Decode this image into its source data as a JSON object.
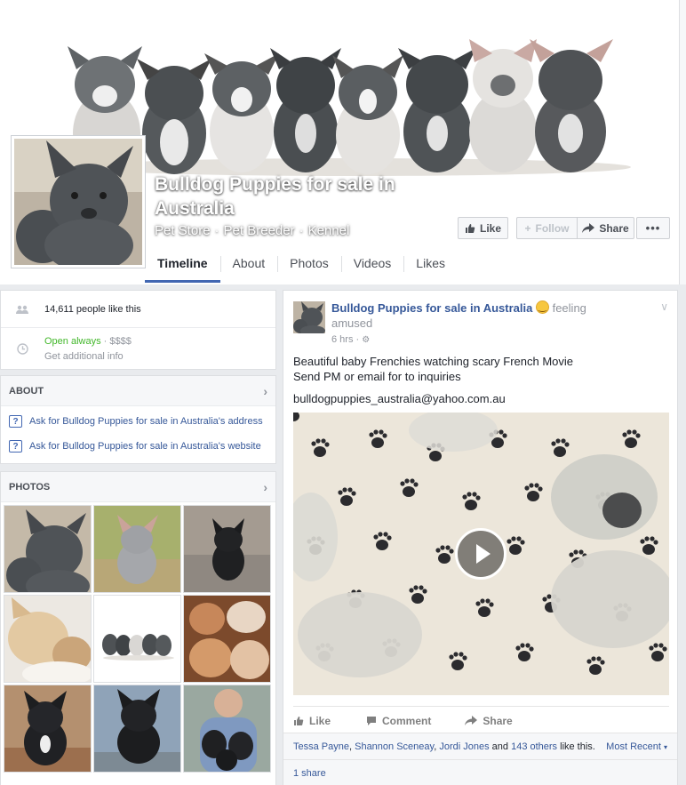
{
  "page": {
    "name": "Bulldog Puppies for sale in Australia",
    "categories": [
      "Pet Store",
      "Pet Breeder",
      "Kennel"
    ]
  },
  "header_buttons": {
    "like": "Like",
    "follow": "Follow",
    "share": "Share",
    "more": "•••"
  },
  "tabs": [
    "Timeline",
    "About",
    "Photos",
    "Videos",
    "Likes"
  ],
  "sidebar": {
    "likes_text": "14,611 people like this",
    "open_text": "Open always",
    "price_sep": " · ",
    "price": "$$$$",
    "additional_info": "Get additional info"
  },
  "about": {
    "heading": "ABOUT",
    "links": [
      "Ask for Bulldog Puppies for sale in Australia's address",
      "Ask for Bulldog Puppies for sale in Australia's website"
    ]
  },
  "photos": {
    "heading": "PHOTOS",
    "count": 9
  },
  "post": {
    "author": "Bulldog Puppies for sale in Australia",
    "feeling": "feeling",
    "feeling_value": "amused",
    "time": "6 hrs",
    "time_sep": " · ",
    "lines": [
      "Beautiful baby Frenchies watching scary French Movie",
      "Send PM or email for to inquiries"
    ],
    "email": "bulldogpuppies_australia@yahoo.com.au",
    "actions": {
      "like": "Like",
      "comment": "Comment",
      "share": "Share"
    },
    "reactions": {
      "name1": "Tessa Payne",
      "name2": "Shannon Sceneay",
      "name3": "Jordi Jones",
      "and": "and",
      "others": "143 others",
      "suffix": "like this."
    },
    "sort": "Most Recent",
    "shares": "1 share"
  },
  "colors": {
    "accent": "#4267b2",
    "link": "#365899",
    "open_green": "#42b72a",
    "page_bg": "#e9ebee"
  },
  "icons": {
    "likes": "people-icon",
    "hours": "clock-icon",
    "about_link": "question-box-icon",
    "visibility": "globe-icon"
  }
}
